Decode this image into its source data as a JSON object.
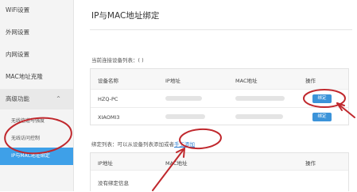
{
  "sidebar": {
    "items": [
      {
        "label": "WiFi设置"
      },
      {
        "label": "外网设置"
      },
      {
        "label": "内网设置"
      },
      {
        "label": "MAC地址克隆"
      },
      {
        "label": "高级功能"
      }
    ],
    "chevron": "^",
    "subitems": [
      {
        "label": "无线信道与强度"
      },
      {
        "label": "无线访问控制"
      },
      {
        "label": "IP与MAC地址绑定"
      }
    ]
  },
  "main": {
    "title": "IP与MAC地址绑定",
    "devices_label": "当前连接设备列表：( )",
    "devices_table": {
      "headers": [
        "设备名称",
        "IP地址",
        "MAC地址",
        "操作"
      ],
      "rows": [
        {
          "name": "HZQ-PC",
          "action": "绑定"
        },
        {
          "name": "XIAOMI3",
          "action": "绑定"
        }
      ]
    },
    "bind_list_label": "绑定列表：可以从设备列表添加或者",
    "manual_add_link": "手工添加",
    "bind_table": {
      "headers": [
        "IP地址",
        "MAC地址",
        "操作"
      ],
      "empty_text": "没有绑定信息"
    }
  },
  "colors": {
    "accent": "#3b93d9",
    "active_nav": "#3ea0e8",
    "annotation": "#c0282d"
  }
}
